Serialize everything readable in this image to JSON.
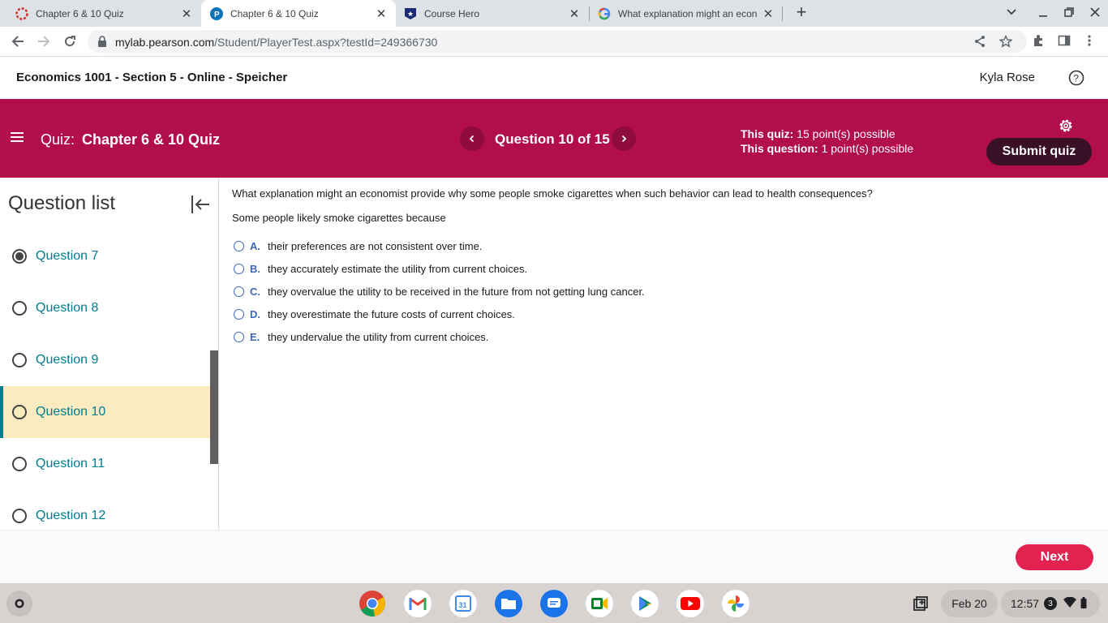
{
  "browser": {
    "tabs": [
      {
        "title": "Chapter 6 & 10 Quiz",
        "favicon": "pearson-red-icon"
      },
      {
        "title": "Chapter 6 & 10 Quiz",
        "favicon": "pearson-p-icon"
      },
      {
        "title": "Course Hero",
        "favicon": "course-hero-icon"
      },
      {
        "title": "What explanation might an econ",
        "favicon": "google-icon"
      }
    ],
    "url_host": "mylab.pearson.com",
    "url_path": "/Student/PlayerTest.aspx?testId=249366730"
  },
  "course": {
    "title": "Economics 1001 - Section 5 - Online - Speicher",
    "user": "Kyla Rose"
  },
  "banner": {
    "quiz_label": "Quiz:",
    "quiz_name": "Chapter 6 & 10 Quiz",
    "question_counter": "Question 10 of 15",
    "this_quiz_label": "This quiz:",
    "this_quiz_value": "15 point(s) possible",
    "this_question_label": "This question:",
    "this_question_value": "1 point(s) possible",
    "submit_label": "Submit quiz",
    "accent_color": "#b10e4b"
  },
  "sidebar": {
    "title": "Question list",
    "items": [
      {
        "label": "Question 7",
        "state": "answered"
      },
      {
        "label": "Question 8",
        "state": "unanswered"
      },
      {
        "label": "Question 9",
        "state": "unanswered"
      },
      {
        "label": "Question 10",
        "state": "current"
      },
      {
        "label": "Question 11",
        "state": "unanswered"
      },
      {
        "label": "Question 12",
        "state": "unanswered"
      }
    ]
  },
  "question": {
    "text": "What explanation might an economist provide why some people smoke cigarettes when such behavior can lead to health consequences?",
    "prompt": "Some people likely smoke cigarettes because",
    "choices": [
      {
        "letter": "A.",
        "text": "their preferences are not consistent over time."
      },
      {
        "letter": "B.",
        "text": "they accurately estimate the utility from current choices."
      },
      {
        "letter": "C.",
        "text": "they overvalue the utility to be received in the future from not getting lung cancer."
      },
      {
        "letter": "D.",
        "text": "they overestimate the future costs of current choices."
      },
      {
        "letter": "E.",
        "text": "they undervalue the utility from current choices."
      }
    ]
  },
  "footer": {
    "next_label": "Next"
  },
  "shelf": {
    "apps": [
      "chrome-icon",
      "gmail-icon",
      "calendar-icon",
      "files-icon",
      "messages-icon",
      "meet-icon",
      "play-store-icon",
      "youtube-icon",
      "photos-icon"
    ],
    "date": "Feb 20",
    "time": "12:57",
    "notification_count": "3"
  }
}
